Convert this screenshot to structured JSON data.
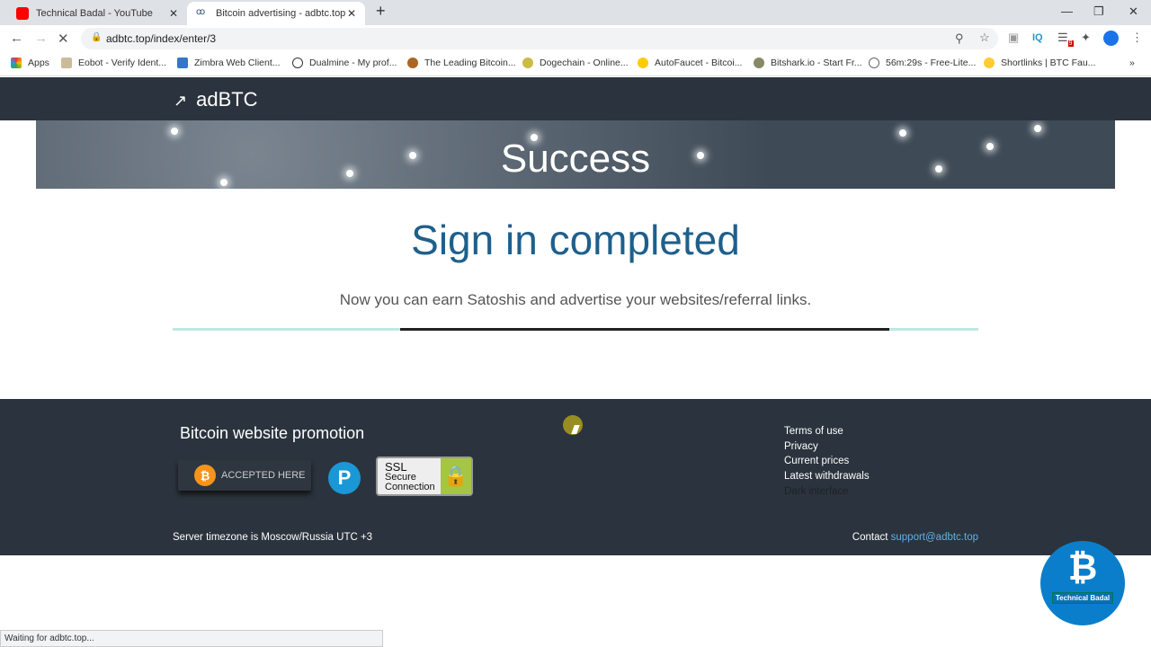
{
  "browser": {
    "tabs": [
      {
        "title": "Technical Badal - YouTube",
        "icon": "youtube-icon",
        "active": false
      },
      {
        "title": "Bitcoin advertising - adbtc.top",
        "icon": "adbtc-icon",
        "active": true
      }
    ],
    "new_tab": "+",
    "url": "adbtc.top/index/enter/3",
    "apps_label": "Apps",
    "bookmarks": [
      "Eobot - Verify Ident...",
      "Zimbra Web Client...",
      "Dualmine - My prof...",
      "The Leading Bitcoin...",
      "Dogechain - Online...",
      "AutoFaucet - Bitcoi...",
      "Bitshark.io - Start Fr...",
      "56m:29s - Free-Lite...",
      "Shortlinks | BTC Fau..."
    ],
    "more_bookmarks": "»",
    "extension_badge": "9",
    "extension_iq": "IQ",
    "status": "Waiting for adbtc.top..."
  },
  "site": {
    "logo": "adBTC",
    "banner": "Success",
    "title": "Sign in completed",
    "subtitle": "Now you can earn Satoshis and advertise your websites/referral links.",
    "progress_percent": 61
  },
  "footer": {
    "promo": "Bitcoin website promotion",
    "btc_badge": "ACCEPTED HERE",
    "p_badge": "P",
    "ssl_badge": [
      "SSL",
      "Secure",
      "Connection"
    ],
    "links": [
      "Terms of use",
      "Privacy",
      "Current prices",
      "Latest withdrawals",
      "Dark interface"
    ],
    "timezone": "Server timezone is Moscow/Russia UTC +3",
    "contact_label": "Contact",
    "contact_email": "support@adbtc.top"
  },
  "watermark": {
    "label": "Technical Badal"
  },
  "colors": {
    "header": "#2b343e",
    "title": "#1f5f8b",
    "link": "#5fb0e6",
    "progress": "#bfe8e3"
  }
}
